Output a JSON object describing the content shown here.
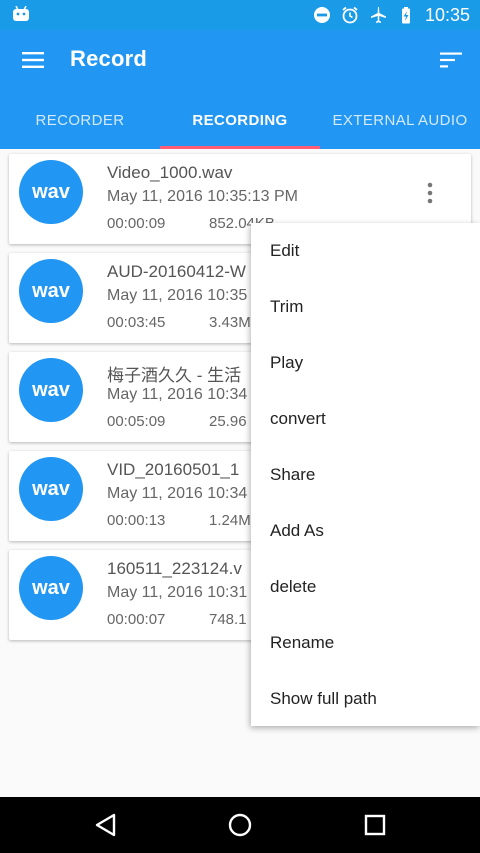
{
  "status_bar": {
    "time": "10:35",
    "icons": [
      "android-icon",
      "do-not-disturb-icon",
      "alarm-icon",
      "airplane-icon",
      "battery-charging-icon"
    ]
  },
  "toolbar": {
    "title": "Record",
    "icons": [
      "menu-icon",
      "sort-icon"
    ]
  },
  "tabs": [
    {
      "label": "RECORDER",
      "active": false
    },
    {
      "label": "RECORDING",
      "active": true
    },
    {
      "label": "EXTERNAL AUDIO",
      "active": false
    }
  ],
  "recordings": [
    {
      "badge": "wav",
      "name": "Video_1000.wav",
      "date": "May 11, 2016 10:35:13 PM",
      "duration": "00:00:09",
      "size": "852.04KB"
    },
    {
      "badge": "wav",
      "name": "AUD-20160412-W",
      "date": "May 11, 2016 10:35",
      "duration": "00:03:45",
      "size": "3.43M"
    },
    {
      "badge": "wav",
      "name": "梅子酒久久 - 生活",
      "date": "May 11, 2016 10:34",
      "duration": "00:05:09",
      "size": "25.96"
    },
    {
      "badge": "wav",
      "name": "VID_20160501_1",
      "date": "May 11, 2016 10:34",
      "duration": "00:00:13",
      "size": "1.24M"
    },
    {
      "badge": "wav",
      "name": "160511_223124.v",
      "date": "May 11, 2016 10:31",
      "duration": "00:00:07",
      "size": "748.1"
    }
  ],
  "popup_menu": {
    "items": [
      "Edit",
      "Trim",
      "Play",
      "convert",
      "Share",
      "Add As",
      "delete",
      "Rename",
      "Show full path"
    ]
  },
  "nav_bar": {
    "icons": [
      "back-icon",
      "home-icon",
      "recents-icon"
    ]
  },
  "colors": {
    "status_bar": "#1a9be8",
    "primary": "#2196f3",
    "tab_indicator": "#ff5d75",
    "badge": "#2196f3"
  }
}
